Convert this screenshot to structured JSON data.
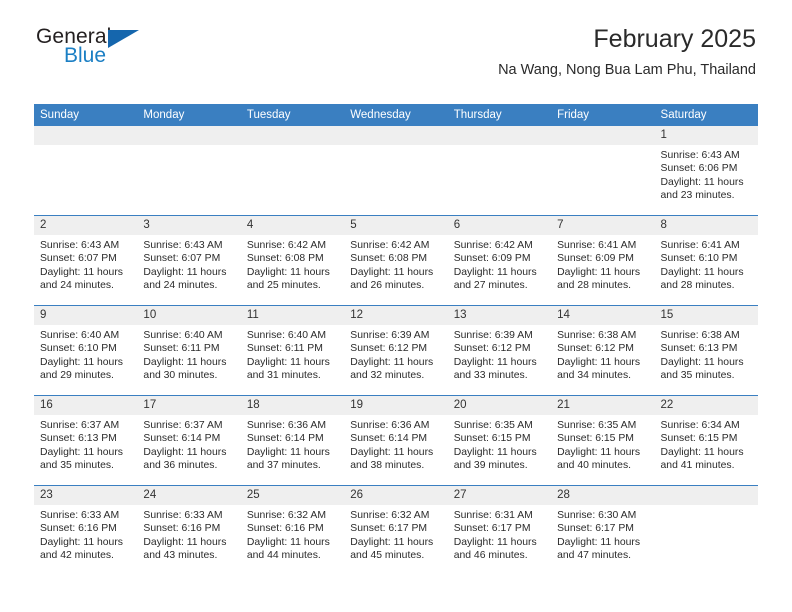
{
  "brand": {
    "name_top": "General",
    "name_bottom": "Blue",
    "triangle_color": "#1566ad",
    "blue_color": "#1b7fc4"
  },
  "header": {
    "title": "February 2025",
    "subtitle": "Na Wang, Nong Bua Lam Phu, Thailand"
  },
  "theme": {
    "header_blue": "#3a7fc1",
    "daynum_band": "#efefef",
    "text": "#2b2b2b"
  },
  "weekdays": [
    "Sunday",
    "Monday",
    "Tuesday",
    "Wednesday",
    "Thursday",
    "Friday",
    "Saturday"
  ],
  "labels": {
    "sunrise": "Sunrise:",
    "sunset": "Sunset:",
    "daylight": "Daylight:"
  },
  "weeks": [
    [
      {
        "day": "",
        "sunrise": "",
        "sunset": "",
        "daylight_line1": "",
        "daylight_line2": ""
      },
      {
        "day": "",
        "sunrise": "",
        "sunset": "",
        "daylight_line1": "",
        "daylight_line2": ""
      },
      {
        "day": "",
        "sunrise": "",
        "sunset": "",
        "daylight_line1": "",
        "daylight_line2": ""
      },
      {
        "day": "",
        "sunrise": "",
        "sunset": "",
        "daylight_line1": "",
        "daylight_line2": ""
      },
      {
        "day": "",
        "sunrise": "",
        "sunset": "",
        "daylight_line1": "",
        "daylight_line2": ""
      },
      {
        "day": "",
        "sunrise": "",
        "sunset": "",
        "daylight_line1": "",
        "daylight_line2": ""
      },
      {
        "day": "1",
        "sunrise": "Sunrise: 6:43 AM",
        "sunset": "Sunset: 6:06 PM",
        "daylight_line1": "Daylight: 11 hours",
        "daylight_line2": "and 23 minutes."
      }
    ],
    [
      {
        "day": "2",
        "sunrise": "Sunrise: 6:43 AM",
        "sunset": "Sunset: 6:07 PM",
        "daylight_line1": "Daylight: 11 hours",
        "daylight_line2": "and 24 minutes."
      },
      {
        "day": "3",
        "sunrise": "Sunrise: 6:43 AM",
        "sunset": "Sunset: 6:07 PM",
        "daylight_line1": "Daylight: 11 hours",
        "daylight_line2": "and 24 minutes."
      },
      {
        "day": "4",
        "sunrise": "Sunrise: 6:42 AM",
        "sunset": "Sunset: 6:08 PM",
        "daylight_line1": "Daylight: 11 hours",
        "daylight_line2": "and 25 minutes."
      },
      {
        "day": "5",
        "sunrise": "Sunrise: 6:42 AM",
        "sunset": "Sunset: 6:08 PM",
        "daylight_line1": "Daylight: 11 hours",
        "daylight_line2": "and 26 minutes."
      },
      {
        "day": "6",
        "sunrise": "Sunrise: 6:42 AM",
        "sunset": "Sunset: 6:09 PM",
        "daylight_line1": "Daylight: 11 hours",
        "daylight_line2": "and 27 minutes."
      },
      {
        "day": "7",
        "sunrise": "Sunrise: 6:41 AM",
        "sunset": "Sunset: 6:09 PM",
        "daylight_line1": "Daylight: 11 hours",
        "daylight_line2": "and 28 minutes."
      },
      {
        "day": "8",
        "sunrise": "Sunrise: 6:41 AM",
        "sunset": "Sunset: 6:10 PM",
        "daylight_line1": "Daylight: 11 hours",
        "daylight_line2": "and 28 minutes."
      }
    ],
    [
      {
        "day": "9",
        "sunrise": "Sunrise: 6:40 AM",
        "sunset": "Sunset: 6:10 PM",
        "daylight_line1": "Daylight: 11 hours",
        "daylight_line2": "and 29 minutes."
      },
      {
        "day": "10",
        "sunrise": "Sunrise: 6:40 AM",
        "sunset": "Sunset: 6:11 PM",
        "daylight_line1": "Daylight: 11 hours",
        "daylight_line2": "and 30 minutes."
      },
      {
        "day": "11",
        "sunrise": "Sunrise: 6:40 AM",
        "sunset": "Sunset: 6:11 PM",
        "daylight_line1": "Daylight: 11 hours",
        "daylight_line2": "and 31 minutes."
      },
      {
        "day": "12",
        "sunrise": "Sunrise: 6:39 AM",
        "sunset": "Sunset: 6:12 PM",
        "daylight_line1": "Daylight: 11 hours",
        "daylight_line2": "and 32 minutes."
      },
      {
        "day": "13",
        "sunrise": "Sunrise: 6:39 AM",
        "sunset": "Sunset: 6:12 PM",
        "daylight_line1": "Daylight: 11 hours",
        "daylight_line2": "and 33 minutes."
      },
      {
        "day": "14",
        "sunrise": "Sunrise: 6:38 AM",
        "sunset": "Sunset: 6:12 PM",
        "daylight_line1": "Daylight: 11 hours",
        "daylight_line2": "and 34 minutes."
      },
      {
        "day": "15",
        "sunrise": "Sunrise: 6:38 AM",
        "sunset": "Sunset: 6:13 PM",
        "daylight_line1": "Daylight: 11 hours",
        "daylight_line2": "and 35 minutes."
      }
    ],
    [
      {
        "day": "16",
        "sunrise": "Sunrise: 6:37 AM",
        "sunset": "Sunset: 6:13 PM",
        "daylight_line1": "Daylight: 11 hours",
        "daylight_line2": "and 35 minutes."
      },
      {
        "day": "17",
        "sunrise": "Sunrise: 6:37 AM",
        "sunset": "Sunset: 6:14 PM",
        "daylight_line1": "Daylight: 11 hours",
        "daylight_line2": "and 36 minutes."
      },
      {
        "day": "18",
        "sunrise": "Sunrise: 6:36 AM",
        "sunset": "Sunset: 6:14 PM",
        "daylight_line1": "Daylight: 11 hours",
        "daylight_line2": "and 37 minutes."
      },
      {
        "day": "19",
        "sunrise": "Sunrise: 6:36 AM",
        "sunset": "Sunset: 6:14 PM",
        "daylight_line1": "Daylight: 11 hours",
        "daylight_line2": "and 38 minutes."
      },
      {
        "day": "20",
        "sunrise": "Sunrise: 6:35 AM",
        "sunset": "Sunset: 6:15 PM",
        "daylight_line1": "Daylight: 11 hours",
        "daylight_line2": "and 39 minutes."
      },
      {
        "day": "21",
        "sunrise": "Sunrise: 6:35 AM",
        "sunset": "Sunset: 6:15 PM",
        "daylight_line1": "Daylight: 11 hours",
        "daylight_line2": "and 40 minutes."
      },
      {
        "day": "22",
        "sunrise": "Sunrise: 6:34 AM",
        "sunset": "Sunset: 6:15 PM",
        "daylight_line1": "Daylight: 11 hours",
        "daylight_line2": "and 41 minutes."
      }
    ],
    [
      {
        "day": "23",
        "sunrise": "Sunrise: 6:33 AM",
        "sunset": "Sunset: 6:16 PM",
        "daylight_line1": "Daylight: 11 hours",
        "daylight_line2": "and 42 minutes."
      },
      {
        "day": "24",
        "sunrise": "Sunrise: 6:33 AM",
        "sunset": "Sunset: 6:16 PM",
        "daylight_line1": "Daylight: 11 hours",
        "daylight_line2": "and 43 minutes."
      },
      {
        "day": "25",
        "sunrise": "Sunrise: 6:32 AM",
        "sunset": "Sunset: 6:16 PM",
        "daylight_line1": "Daylight: 11 hours",
        "daylight_line2": "and 44 minutes."
      },
      {
        "day": "26",
        "sunrise": "Sunrise: 6:32 AM",
        "sunset": "Sunset: 6:17 PM",
        "daylight_line1": "Daylight: 11 hours",
        "daylight_line2": "and 45 minutes."
      },
      {
        "day": "27",
        "sunrise": "Sunrise: 6:31 AM",
        "sunset": "Sunset: 6:17 PM",
        "daylight_line1": "Daylight: 11 hours",
        "daylight_line2": "and 46 minutes."
      },
      {
        "day": "28",
        "sunrise": "Sunrise: 6:30 AM",
        "sunset": "Sunset: 6:17 PM",
        "daylight_line1": "Daylight: 11 hours",
        "daylight_line2": "and 47 minutes."
      },
      {
        "day": "",
        "sunrise": "",
        "sunset": "",
        "daylight_line1": "",
        "daylight_line2": ""
      }
    ]
  ]
}
